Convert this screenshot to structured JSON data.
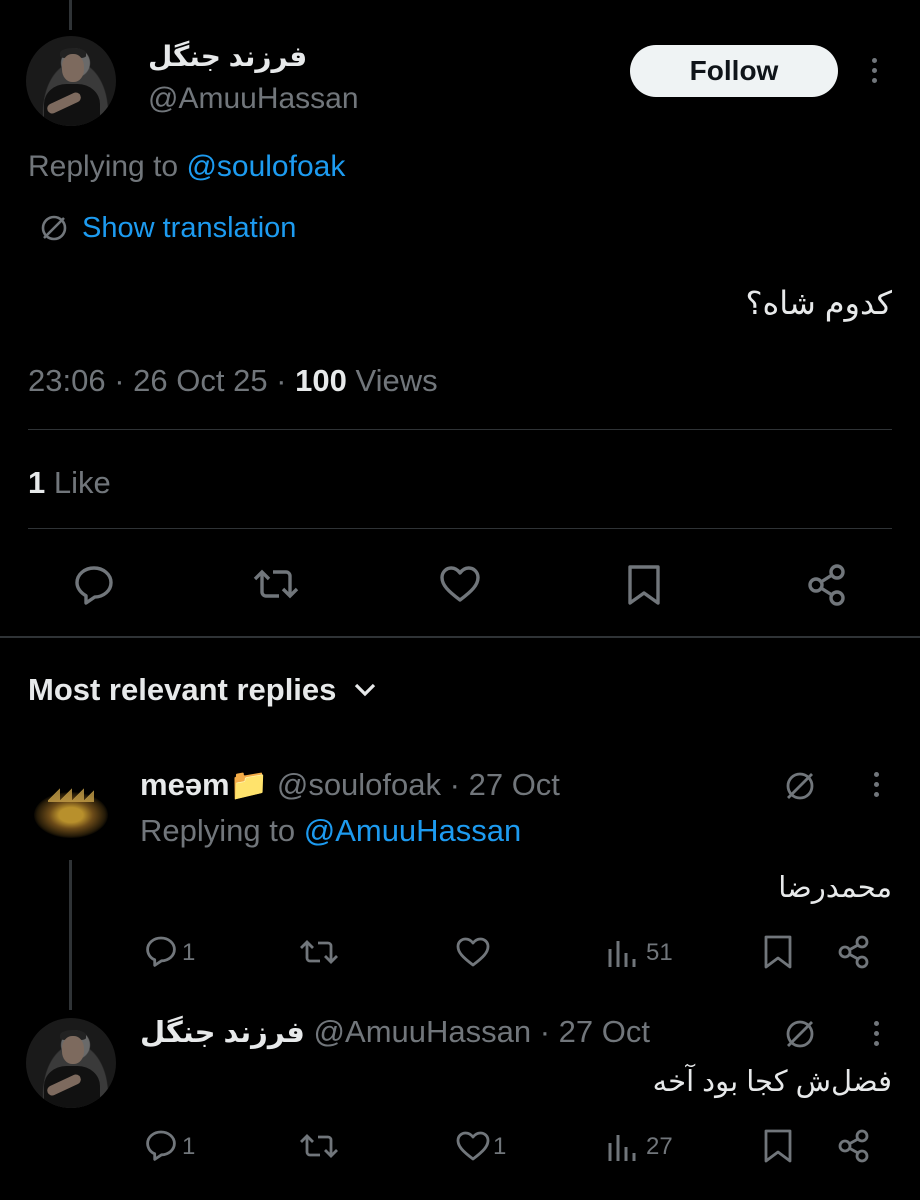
{
  "tweet": {
    "display_name": "فرزند جنگل",
    "handle": "@AmuuHassan",
    "follow_label": "Follow",
    "replying_prefix": "Replying to ",
    "replying_to": "@soulofoak",
    "translation_label": "Show translation",
    "text": "کدوم شاه؟",
    "time": "23:06",
    "sep1": " · ",
    "date": "26 Oct 25",
    "sep2": " · ",
    "views_count": "100",
    "views_label": " Views",
    "likes_count": "1",
    "likes_label": " Like"
  },
  "replies_header": {
    "label": "Most relevant replies"
  },
  "replies": [
    {
      "display_name": "meəm",
      "emoji": "📁",
      "handle": "@soulofoak",
      "sep": " · ",
      "date": "27 Oct",
      "replying_prefix": "Replying to ",
      "replying_to": "@AmuuHassan",
      "text": "محمدرضا",
      "reply_count": "1",
      "like_count": "",
      "views_count": "51"
    },
    {
      "display_name": "فرزند جنگل",
      "handle": "@AmuuHassan",
      "sep": " · ",
      "date": "27 Oct",
      "text": "فضل‌ش کجا بود آخه",
      "reply_count": "1",
      "like_count": "1",
      "views_count": "27"
    }
  ],
  "colors": {
    "background": "#000000",
    "text": "#e7e9ea",
    "muted": "#71767b",
    "accent": "#1d9bf0",
    "divider": "#2f3336"
  },
  "icons": [
    "more-icon",
    "translate-icon",
    "reply-icon",
    "retweet-icon",
    "like-icon",
    "bookmark-icon",
    "share-icon",
    "views-icon",
    "chevron-down-icon"
  ]
}
